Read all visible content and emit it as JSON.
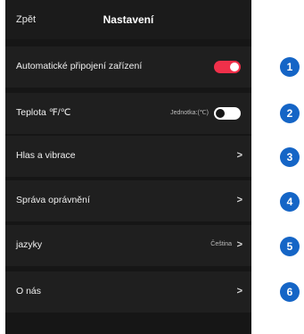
{
  "header": {
    "back_label": "Zpět",
    "title": "Nastavení"
  },
  "rows": [
    {
      "label": "Automatické připojení zařízení",
      "control": "toggle",
      "state": "on",
      "accent": "#f0304a"
    },
    {
      "label": "Teplota ℉/℃",
      "hint": "Jednotka:(℃)",
      "control": "toggle",
      "state": "off"
    },
    {
      "label": "Hlas a vibrace",
      "control": "chevron"
    },
    {
      "label": "Správa oprávnění",
      "control": "chevron"
    },
    {
      "label": "jazyky",
      "hint": "Čeština",
      "control": "chevron"
    },
    {
      "label": "O nás",
      "control": "chevron"
    }
  ],
  "chevron_glyph": ">",
  "badges": [
    "1",
    "2",
    "3",
    "4",
    "5",
    "6"
  ],
  "colors": {
    "background": "#161616",
    "row": "#1f1f1f",
    "toggle_on": "#f0304a",
    "badge": "#1565c6"
  }
}
